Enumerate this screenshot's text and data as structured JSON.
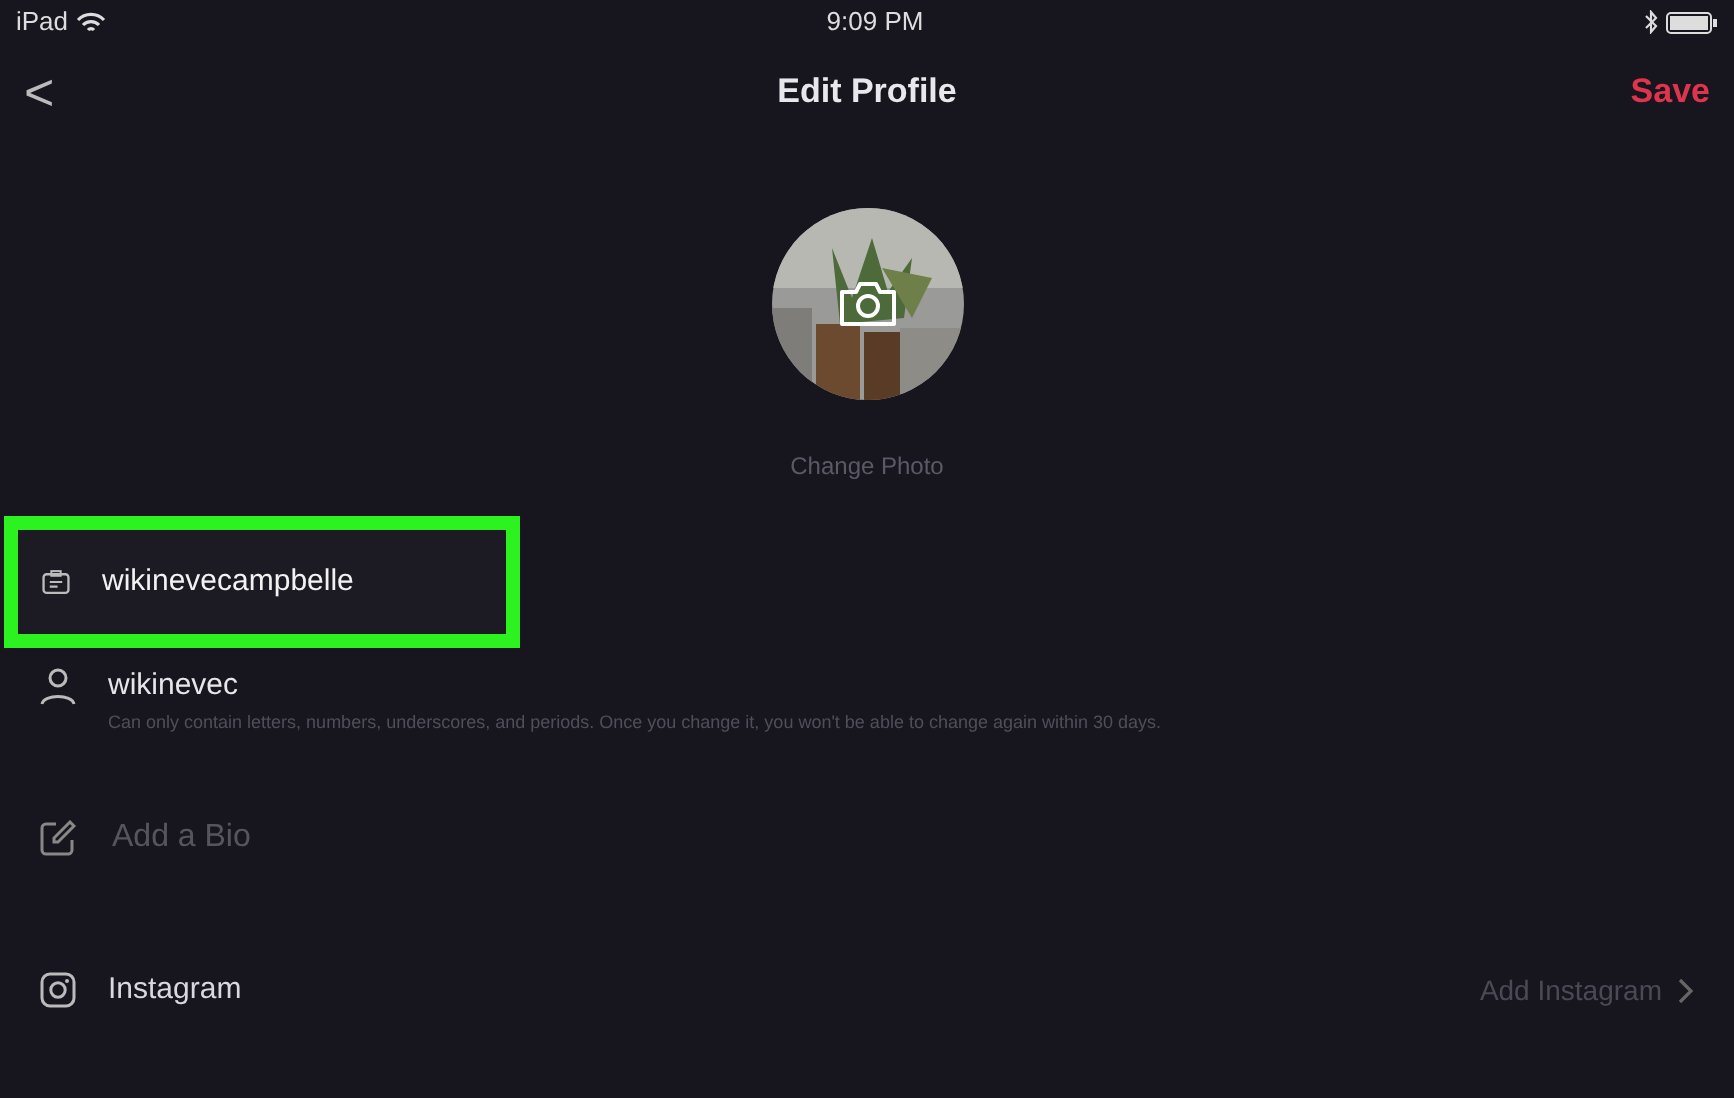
{
  "status_bar": {
    "device": "iPad",
    "time": "9:09 PM"
  },
  "nav": {
    "back": "<",
    "title": "Edit Profile",
    "save": "Save"
  },
  "photo": {
    "kind": "picture",
    "label": "Change Photo"
  },
  "name_field": {
    "value": "wikinevecampbelle",
    "highlighted": true
  },
  "username": {
    "value": "wikinevec",
    "hint": "Can only contain letters, numbers, underscores, and periods. Once you change it, you won't be able to change again within 30 days."
  },
  "bio": {
    "placeholder": "Add a Bio"
  },
  "social": [
    {
      "label": "Instagram",
      "action": "Add Instagram"
    }
  ]
}
